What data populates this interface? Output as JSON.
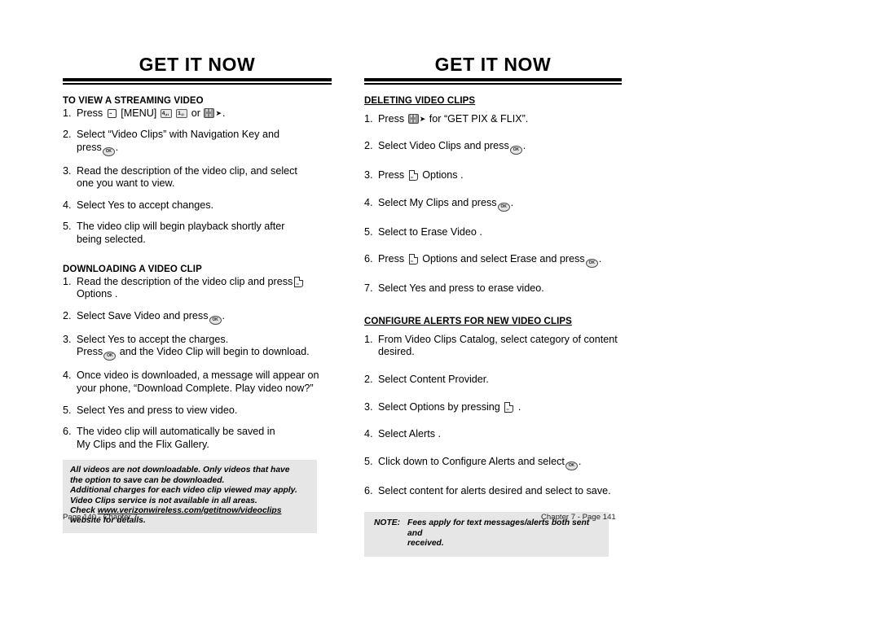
{
  "document": {
    "left_page": {
      "header": "GET IT NOW",
      "footer": "Page 140 - Chapter 7",
      "sections": [
        {
          "title": "TO VIEW A STREAMING VIDEO",
          "steps": [
            {
              "num": "1.",
              "pre": "Press",
              "mid": "[MENU]",
              "post": "or",
              "tail": "."
            },
            {
              "num": "2.",
              "line1": "Select “Video Clips” with Navigation Key and",
              "line2_pre": "press",
              "line2_post": "."
            },
            {
              "num": "3.",
              "line1": "Read the description of the video clip, and select",
              "line2": "one you want to view."
            },
            {
              "num": "4.",
              "line1": "Select Yes to accept changes."
            },
            {
              "num": "5.",
              "line1": "The video clip will begin playback shortly after",
              "line2": "being selected."
            }
          ]
        },
        {
          "title": "DOWNLOADING A VIDEO CLIP",
          "steps": [
            {
              "num": "1.",
              "line1_pre": "Read the description of the video clip and press",
              "line2": "Options ."
            },
            {
              "num": "2.",
              "pre": "Select Save Video  and press",
              "tail": "."
            },
            {
              "num": "3.",
              "line1": "Select Yes to accept the charges.",
              "line2_pre": "Press",
              "line2_post": "and the Video Clip will begin to download."
            },
            {
              "num": "4.",
              "line1": "Once video is downloaded, a message will appear on",
              "line2": "your phone, “Download Complete. Play video now?”"
            },
            {
              "num": "5.",
              "line1": "Select Yes and press to view video."
            },
            {
              "num": "6.",
              "line1": "The video clip will automatically be saved in",
              "line2": "My Clips and the Flix Gallery."
            }
          ]
        }
      ],
      "notebox": {
        "line1": "All videos are not downloadable. Only videos that have",
        "line2": "the option to save can be downloaded.",
        "line3": "Additional charges for each video clip viewed may apply.",
        "line4": "Video Clips service is not available in all areas.",
        "line5_pre": "Check ",
        "line5_url": "www.verizonwireless.com/getitnow/videoclips",
        "line6": "website for details."
      }
    },
    "right_page": {
      "header": "GET IT NOW",
      "footer": "Chapter 7 - Page 141",
      "sections": [
        {
          "title": "DELETING VIDEO CLIPS",
          "steps": [
            {
              "num": "1.",
              "pre": "Press",
              "post": "for “GET PIX & FLIX”."
            },
            {
              "num": "2.",
              "pre": "Select Video Clips  and press",
              "tail": "."
            },
            {
              "num": "3.",
              "pre": "Press",
              "post": "Options ."
            },
            {
              "num": "4.",
              "pre": "Select My Clips  and press",
              "tail": "."
            },
            {
              "num": "5.",
              "line1": "Select to Erase Video ."
            },
            {
              "num": "6.",
              "pre": "Press",
              "mid": "Options  and select Erase and press",
              "tail": "."
            },
            {
              "num": "7.",
              "line1": "Select Yes and press to erase video."
            }
          ]
        },
        {
          "title": "CONFIGURE ALERTS FOR NEW VIDEO CLIPS",
          "steps": [
            {
              "num": "1.",
              "line1": "From Video Clips Catalog, select category of content",
              "line2": "desired."
            },
            {
              "num": "2.",
              "line1": "Select Content Provider."
            },
            {
              "num": "3.",
              "pre": "Select Options  by pressing",
              "tail": "."
            },
            {
              "num": "4.",
              "line1": "Select Alerts ."
            },
            {
              "num": "5.",
              "pre": "Click down to Configure Alerts   and select",
              "tail": "."
            },
            {
              "num": "6.",
              "line1": "Select content for alerts desired and select to save."
            }
          ]
        }
      ],
      "notebox": {
        "label": "NOTE:",
        "line1": "Fees apply for text messages/alerts both sent and",
        "line2": "received."
      }
    },
    "keys": {
      "ok_label": "OK",
      "num_four": "4",
      "num_four_sub": "ghi",
      "num_one": "1",
      "num_one_sub": "@."
    }
  }
}
